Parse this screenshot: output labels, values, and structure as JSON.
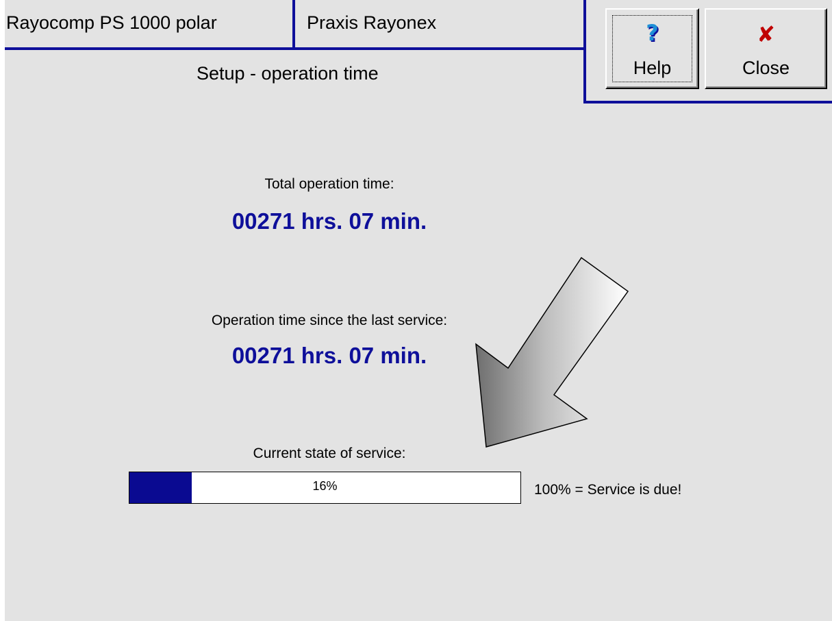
{
  "header": {
    "device_name": "Rayocomp PS 1000 polar",
    "practice_name": "Praxis Rayonex",
    "page_title": "Setup - operation time"
  },
  "buttons": {
    "help": {
      "label": "Help",
      "icon": "question-mark-icon",
      "icon_glyph": "?"
    },
    "close": {
      "label": "Close",
      "icon": "red-x-icon",
      "icon_glyph": "✘"
    }
  },
  "operation": {
    "total_label": "Total operation time:",
    "total_value": "00271 hrs. 07 min.",
    "since_service_label": "Operation time since the last service:",
    "since_service_value": "00271 hrs. 07 min."
  },
  "service": {
    "state_label": "Current state of service:",
    "progress_percent": 16,
    "progress_text": "16%",
    "due_note": "100% = Service is due!"
  },
  "colors": {
    "accent_blue": "#0e0f9a",
    "progress_fill": "#0a0a91",
    "background": "#e3e3e3",
    "close_icon": "#c00000",
    "help_icon": "#1e8fd6"
  }
}
